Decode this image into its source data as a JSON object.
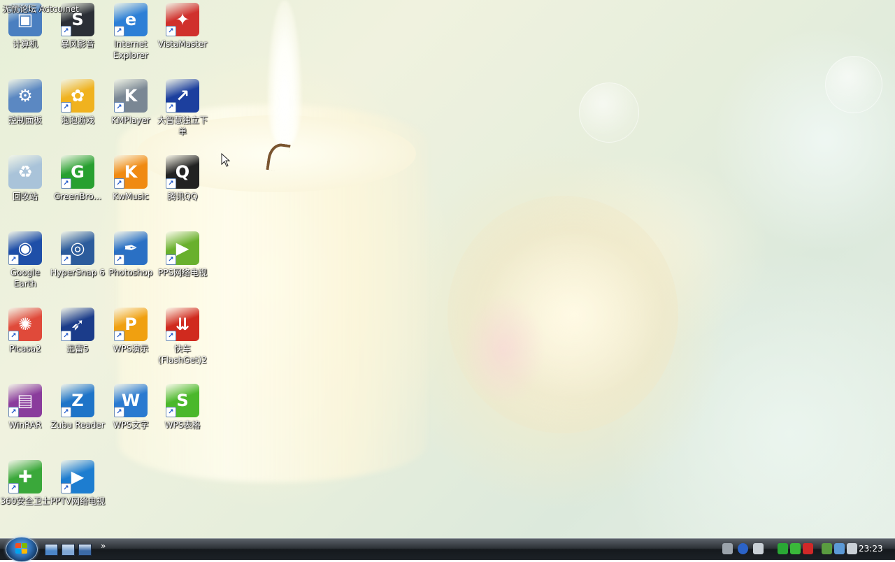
{
  "watermark": "无忧论坛 Actcu.net",
  "desktop_icons": [
    {
      "label": "计算机",
      "icon": "computer-icon",
      "color": "#4a7fc0",
      "glyph": "▣"
    },
    {
      "label": "暴风影音",
      "icon": "storm-player-icon",
      "color": "#2b2f36",
      "glyph": "S"
    },
    {
      "label": "Internet Explorer",
      "icon": "internet-explorer-icon",
      "color": "#2d7fd6",
      "glyph": "e"
    },
    {
      "label": "VistaMaster",
      "icon": "vistamaster-icon",
      "color": "#d0302c",
      "glyph": "✦"
    },
    {
      "label": "控制面板",
      "icon": "control-panel-icon",
      "color": "#5b88c2",
      "glyph": "⚙"
    },
    {
      "label": "泡泡游戏",
      "icon": "paopao-game-icon",
      "color": "#f0b21f",
      "glyph": "✿"
    },
    {
      "label": "KMPlayer",
      "icon": "kmplayer-icon",
      "color": "#7a8794",
      "glyph": "K"
    },
    {
      "label": "大智慧独立下单",
      "icon": "dzh-trading-icon",
      "color": "#1c3f9e",
      "glyph": "↗"
    },
    {
      "label": "回收站",
      "icon": "recycle-bin-icon",
      "color": "#a9c3d9",
      "glyph": "♻"
    },
    {
      "label": "GreenBro...",
      "icon": "greenbrowser-icon",
      "color": "#28a030",
      "glyph": "G"
    },
    {
      "label": "KwMusic",
      "icon": "kwmusic-icon",
      "color": "#f08a12",
      "glyph": "K"
    },
    {
      "label": "腾讯QQ",
      "icon": "qq-penguin-icon",
      "color": "#222222",
      "glyph": "Q"
    },
    {
      "label": "Google Earth",
      "icon": "google-earth-icon",
      "color": "#1f4fa8",
      "glyph": "◉"
    },
    {
      "label": "HyperSnap 6",
      "icon": "hypersnap-icon",
      "color": "#2c5c9c",
      "glyph": "◎"
    },
    {
      "label": "Photoshop",
      "icon": "photoshop-feather-icon",
      "color": "#2a70c4",
      "glyph": "✒"
    },
    {
      "label": "PPS网络电视",
      "icon": "pps-tv-icon",
      "color": "#69b02d",
      "glyph": "▶"
    },
    {
      "label": "Picasa2",
      "icon": "picasa-icon",
      "color": "#e04a3a",
      "glyph": "✺"
    },
    {
      "label": "迅雷5",
      "icon": "thunder-icon",
      "color": "#1b3c8a",
      "glyph": "➶"
    },
    {
      "label": "WPS演示",
      "icon": "wps-presentation-icon",
      "color": "#f0a010",
      "glyph": "P"
    },
    {
      "label": "快车(FlashGet)2",
      "icon": "flashget-icon",
      "color": "#d02a1e",
      "glyph": "⇊"
    },
    {
      "label": "WinRAR",
      "icon": "winrar-icon",
      "color": "#8a3c9c",
      "glyph": "▤"
    },
    {
      "label": "Zubu Reader",
      "icon": "zubu-reader-icon",
      "color": "#1e74c8",
      "glyph": "Z"
    },
    {
      "label": "WPS文字",
      "icon": "wps-writer-icon",
      "color": "#2a7ad0",
      "glyph": "W"
    },
    {
      "label": "WPS表格",
      "icon": "wps-spreadsheet-icon",
      "color": "#4bb82b",
      "glyph": "S"
    },
    {
      "label": "360安全卫士",
      "icon": "360-safe-icon",
      "color": "#3aa83a",
      "glyph": "✚"
    },
    {
      "label": "PPTV网络电视",
      "icon": "pptv-icon",
      "color": "#1d7dd0",
      "glyph": "▶"
    }
  ],
  "taskbar": {
    "start_label": "Start",
    "quick_launch": [
      {
        "icon": "show-desktop-icon",
        "color": "#4c86c8"
      },
      {
        "icon": "switch-windows-icon",
        "color": "#7fa6d4"
      },
      {
        "icon": "window-icon",
        "color": "#3c6aa6"
      }
    ],
    "overflow_glyph": "»",
    "tray": [
      {
        "icon": "keyboard-icon",
        "color": "#9ba3ab"
      },
      {
        "icon": "help-icon",
        "color": "#2b63c8"
      },
      {
        "icon": "language-bar-icon",
        "color": "#c9d0d6"
      },
      {
        "icon": "greenbrowser-tray-icon",
        "color": "#2aa835"
      },
      {
        "icon": "360-tray-icon",
        "color": "#3ab83a"
      },
      {
        "icon": "antivirus-tray-icon",
        "color": "#d02828"
      },
      {
        "icon": "safely-remove-icon",
        "color": "#5a9c40"
      },
      {
        "icon": "network-icon",
        "color": "#5c9ad6"
      },
      {
        "icon": "volume-icon",
        "color": "#c9d0d6"
      }
    ],
    "clock": "23:23"
  }
}
